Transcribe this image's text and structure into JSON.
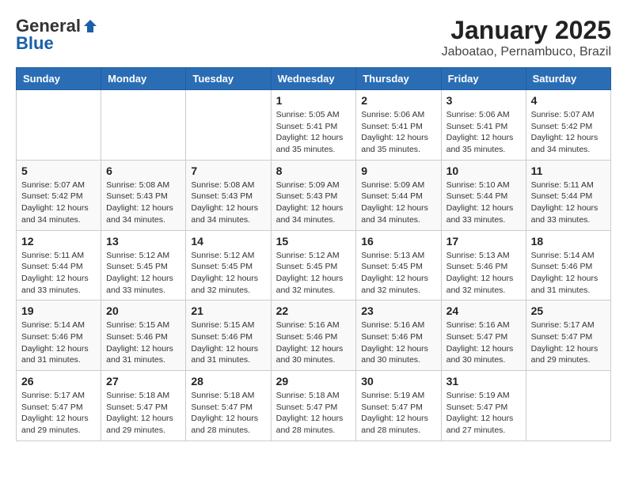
{
  "header": {
    "logo_general": "General",
    "logo_blue": "Blue",
    "month_title": "January 2025",
    "location": "Jaboatao, Pernambuco, Brazil"
  },
  "weekdays": [
    "Sunday",
    "Monday",
    "Tuesday",
    "Wednesday",
    "Thursday",
    "Friday",
    "Saturday"
  ],
  "weeks": [
    [
      {
        "day": "",
        "info": ""
      },
      {
        "day": "",
        "info": ""
      },
      {
        "day": "",
        "info": ""
      },
      {
        "day": "1",
        "info": "Sunrise: 5:05 AM\nSunset: 5:41 PM\nDaylight: 12 hours\nand 35 minutes."
      },
      {
        "day": "2",
        "info": "Sunrise: 5:06 AM\nSunset: 5:41 PM\nDaylight: 12 hours\nand 35 minutes."
      },
      {
        "day": "3",
        "info": "Sunrise: 5:06 AM\nSunset: 5:41 PM\nDaylight: 12 hours\nand 35 minutes."
      },
      {
        "day": "4",
        "info": "Sunrise: 5:07 AM\nSunset: 5:42 PM\nDaylight: 12 hours\nand 34 minutes."
      }
    ],
    [
      {
        "day": "5",
        "info": "Sunrise: 5:07 AM\nSunset: 5:42 PM\nDaylight: 12 hours\nand 34 minutes."
      },
      {
        "day": "6",
        "info": "Sunrise: 5:08 AM\nSunset: 5:43 PM\nDaylight: 12 hours\nand 34 minutes."
      },
      {
        "day": "7",
        "info": "Sunrise: 5:08 AM\nSunset: 5:43 PM\nDaylight: 12 hours\nand 34 minutes."
      },
      {
        "day": "8",
        "info": "Sunrise: 5:09 AM\nSunset: 5:43 PM\nDaylight: 12 hours\nand 34 minutes."
      },
      {
        "day": "9",
        "info": "Sunrise: 5:09 AM\nSunset: 5:44 PM\nDaylight: 12 hours\nand 34 minutes."
      },
      {
        "day": "10",
        "info": "Sunrise: 5:10 AM\nSunset: 5:44 PM\nDaylight: 12 hours\nand 33 minutes."
      },
      {
        "day": "11",
        "info": "Sunrise: 5:11 AM\nSunset: 5:44 PM\nDaylight: 12 hours\nand 33 minutes."
      }
    ],
    [
      {
        "day": "12",
        "info": "Sunrise: 5:11 AM\nSunset: 5:44 PM\nDaylight: 12 hours\nand 33 minutes."
      },
      {
        "day": "13",
        "info": "Sunrise: 5:12 AM\nSunset: 5:45 PM\nDaylight: 12 hours\nand 33 minutes."
      },
      {
        "day": "14",
        "info": "Sunrise: 5:12 AM\nSunset: 5:45 PM\nDaylight: 12 hours\nand 32 minutes."
      },
      {
        "day": "15",
        "info": "Sunrise: 5:12 AM\nSunset: 5:45 PM\nDaylight: 12 hours\nand 32 minutes."
      },
      {
        "day": "16",
        "info": "Sunrise: 5:13 AM\nSunset: 5:45 PM\nDaylight: 12 hours\nand 32 minutes."
      },
      {
        "day": "17",
        "info": "Sunrise: 5:13 AM\nSunset: 5:46 PM\nDaylight: 12 hours\nand 32 minutes."
      },
      {
        "day": "18",
        "info": "Sunrise: 5:14 AM\nSunset: 5:46 PM\nDaylight: 12 hours\nand 31 minutes."
      }
    ],
    [
      {
        "day": "19",
        "info": "Sunrise: 5:14 AM\nSunset: 5:46 PM\nDaylight: 12 hours\nand 31 minutes."
      },
      {
        "day": "20",
        "info": "Sunrise: 5:15 AM\nSunset: 5:46 PM\nDaylight: 12 hours\nand 31 minutes."
      },
      {
        "day": "21",
        "info": "Sunrise: 5:15 AM\nSunset: 5:46 PM\nDaylight: 12 hours\nand 31 minutes."
      },
      {
        "day": "22",
        "info": "Sunrise: 5:16 AM\nSunset: 5:46 PM\nDaylight: 12 hours\nand 30 minutes."
      },
      {
        "day": "23",
        "info": "Sunrise: 5:16 AM\nSunset: 5:46 PM\nDaylight: 12 hours\nand 30 minutes."
      },
      {
        "day": "24",
        "info": "Sunrise: 5:16 AM\nSunset: 5:47 PM\nDaylight: 12 hours\nand 30 minutes."
      },
      {
        "day": "25",
        "info": "Sunrise: 5:17 AM\nSunset: 5:47 PM\nDaylight: 12 hours\nand 29 minutes."
      }
    ],
    [
      {
        "day": "26",
        "info": "Sunrise: 5:17 AM\nSunset: 5:47 PM\nDaylight: 12 hours\nand 29 minutes."
      },
      {
        "day": "27",
        "info": "Sunrise: 5:18 AM\nSunset: 5:47 PM\nDaylight: 12 hours\nand 29 minutes."
      },
      {
        "day": "28",
        "info": "Sunrise: 5:18 AM\nSunset: 5:47 PM\nDaylight: 12 hours\nand 28 minutes."
      },
      {
        "day": "29",
        "info": "Sunrise: 5:18 AM\nSunset: 5:47 PM\nDaylight: 12 hours\nand 28 minutes."
      },
      {
        "day": "30",
        "info": "Sunrise: 5:19 AM\nSunset: 5:47 PM\nDaylight: 12 hours\nand 28 minutes."
      },
      {
        "day": "31",
        "info": "Sunrise: 5:19 AM\nSunset: 5:47 PM\nDaylight: 12 hours\nand 27 minutes."
      },
      {
        "day": "",
        "info": ""
      }
    ]
  ]
}
